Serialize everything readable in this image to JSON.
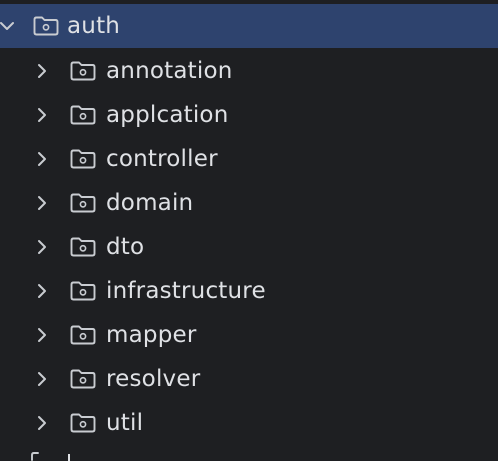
{
  "tree": {
    "root": {
      "label": "auth",
      "icon": "folder-package-icon",
      "expanded": true,
      "selected": true
    },
    "children": [
      {
        "label": "annotation",
        "icon": "folder-package-icon",
        "expanded": false
      },
      {
        "label": "applcation",
        "icon": "folder-package-icon",
        "expanded": false
      },
      {
        "label": "controller",
        "icon": "folder-package-icon",
        "expanded": false
      },
      {
        "label": "domain",
        "icon": "folder-package-icon",
        "expanded": false
      },
      {
        "label": "dto",
        "icon": "folder-package-icon",
        "expanded": false
      },
      {
        "label": "infrastructure",
        "icon": "folder-package-icon",
        "expanded": false
      },
      {
        "label": "mapper",
        "icon": "folder-package-icon",
        "expanded": false
      },
      {
        "label": "resolver",
        "icon": "folder-package-icon",
        "expanded": false
      },
      {
        "label": "util",
        "icon": "folder-package-icon",
        "expanded": false
      }
    ]
  },
  "colors": {
    "background": "#1e1f22",
    "selection": "#2e436e",
    "text": "#dfe1e5",
    "icon": "#c9ccd1"
  }
}
